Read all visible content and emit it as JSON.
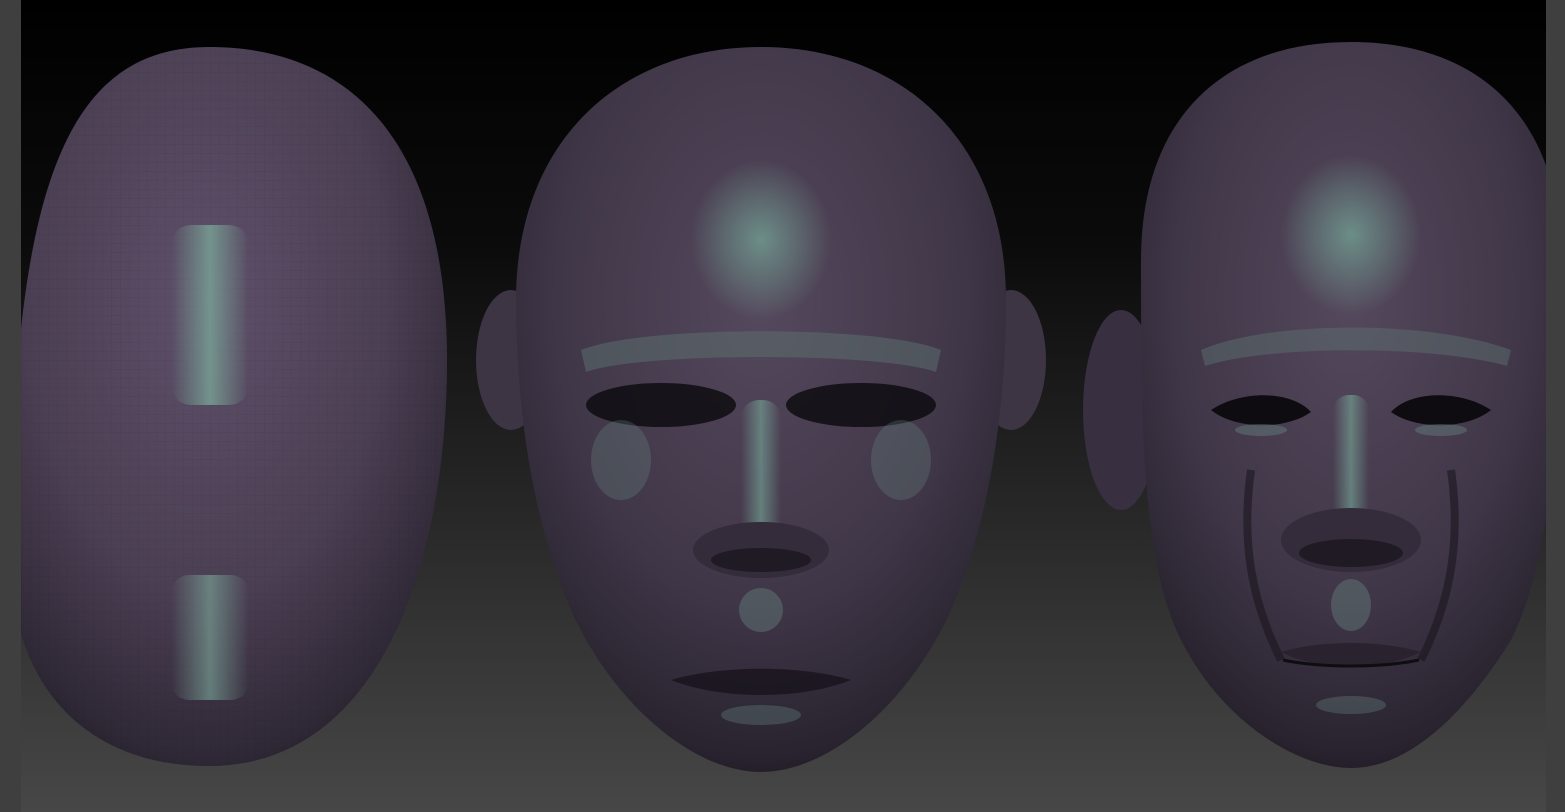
{
  "app": {
    "canvas": {
      "background_top": "#000000",
      "background_bottom": "#474747"
    },
    "models": [
      {
        "stage": "base-sphere",
        "icon": "egg-mesh-icon",
        "skin_color": "#4d4052",
        "highlight_color": "#78a094"
      },
      {
        "stage": "blockout",
        "icon": "head-blockout-icon",
        "skin_color": "#4a4150",
        "highlight_color": "#6f968c"
      },
      {
        "stage": "refined",
        "icon": "head-detail-icon",
        "skin_color": "#4a4150",
        "highlight_color": "#6f968c"
      }
    ],
    "frame_color": "#3f3f3f"
  }
}
